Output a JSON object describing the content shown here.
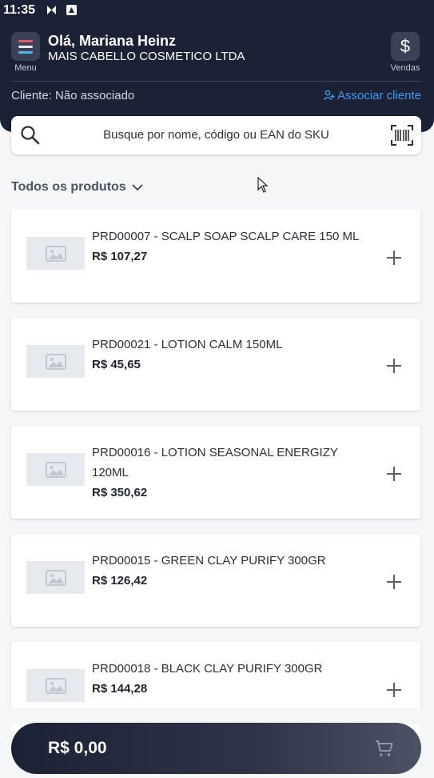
{
  "status": {
    "time": "11:35"
  },
  "header": {
    "greeting": "Olá, Mariana Heinz",
    "company": "MAIS CABELLO COSMETICO LTDA",
    "menu_label": "Menu",
    "sales_label": "Vendas",
    "sales_symbol": "$",
    "client_text": "Cliente: Não associado",
    "associate_label": "Associar cliente"
  },
  "search": {
    "placeholder": "Busque por nome, código ou EAN do SKU"
  },
  "filter": {
    "label": "Todos os produtos"
  },
  "products": [
    {
      "name": "PRD00007 - SCALP SOAP SCALP CARE 150 ML",
      "price": "R$ 107,27"
    },
    {
      "name": "PRD00021 - LOTION CALM 150ML",
      "price": "R$ 45,65"
    },
    {
      "name": "PRD00016 - LOTION SEASONAL ENERGIZY 120ML",
      "price": "R$ 350,62"
    },
    {
      "name": "PRD00015 - GREEN CLAY PURIFY 300GR",
      "price": "R$ 126,42"
    },
    {
      "name": "PRD00018 - BLACK CLAY PURIFY 300GR",
      "price": "R$ 144,28"
    }
  ],
  "cart": {
    "total": "R$ 0,00"
  },
  "colors": {
    "header_bg": "#1b2236",
    "link": "#3e9cf0",
    "page_bg": "#f5f6f8"
  },
  "icons": [
    "menu-icon",
    "dollar-icon",
    "add-user-icon",
    "search-icon",
    "barcode-icon",
    "chevron-down-icon",
    "image-placeholder-icon",
    "plus-icon",
    "cart-icon"
  ]
}
